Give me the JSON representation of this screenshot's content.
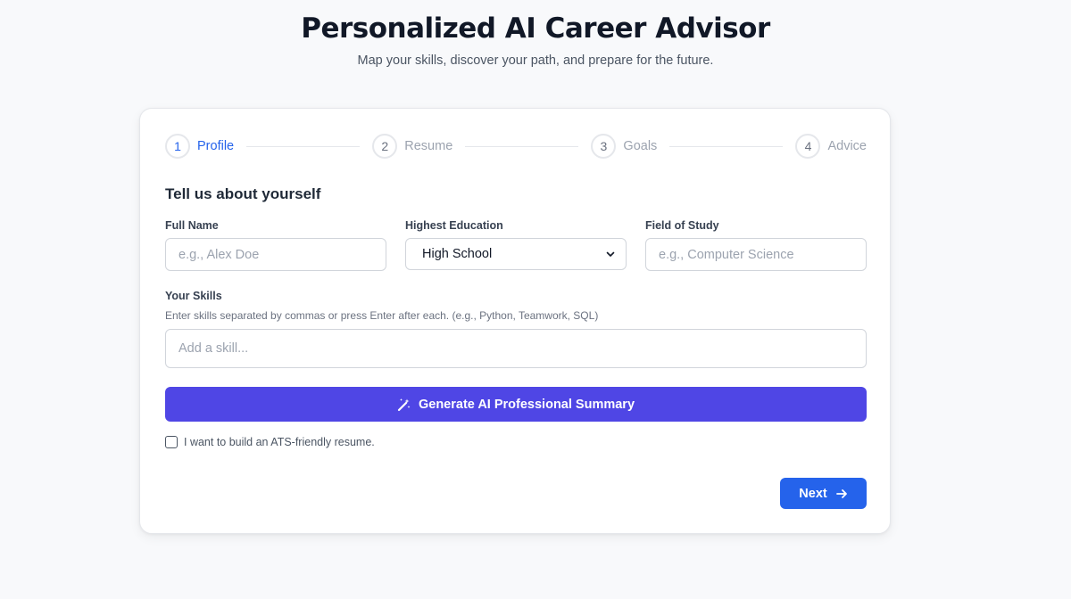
{
  "header": {
    "title": "Personalized AI Career Advisor",
    "subtitle": "Map your skills, discover your path, and prepare for the future."
  },
  "stepper": {
    "steps": [
      {
        "number": "1",
        "label": "Profile",
        "active": true
      },
      {
        "number": "2",
        "label": "Resume",
        "active": false
      },
      {
        "number": "3",
        "label": "Goals",
        "active": false
      },
      {
        "number": "4",
        "label": "Advice",
        "active": false
      }
    ]
  },
  "form": {
    "section_title": "Tell us about yourself",
    "full_name": {
      "label": "Full Name",
      "placeholder": "e.g., Alex Doe",
      "value": ""
    },
    "education": {
      "label": "Highest Education",
      "selected": "High School"
    },
    "field_of_study": {
      "label": "Field of Study",
      "placeholder": "e.g., Computer Science",
      "value": ""
    },
    "skills": {
      "label": "Your Skills",
      "help": "Enter skills separated by commas or press Enter after each. (e.g., Python, Teamwork, SQL)",
      "placeholder": "Add a skill..."
    },
    "generate_button": "Generate AI Professional Summary",
    "ats_checkbox": {
      "label": "I want to build an ATS-friendly resume.",
      "checked": false
    },
    "next_button": "Next"
  },
  "colors": {
    "accent": "#2563eb",
    "generate": "#4f46e5",
    "background": "#f8f9fb"
  },
  "icons": {
    "generate": "magic-wand-icon",
    "next": "arrow-right-icon",
    "select": "chevron-down-icon"
  }
}
